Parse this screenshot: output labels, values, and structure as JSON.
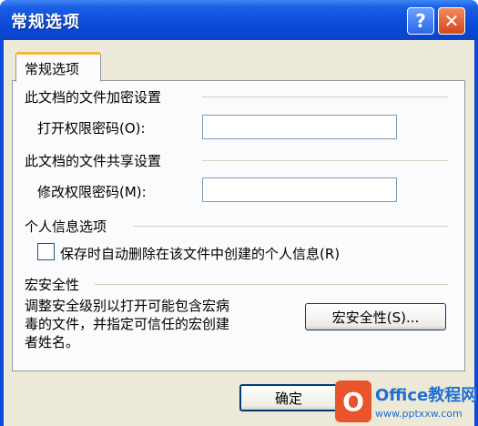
{
  "window": {
    "title": "常规选项",
    "help_label": "?",
    "close_label": "✕"
  },
  "tab": {
    "label": "常规选项"
  },
  "encryption": {
    "heading": "此文档的文件加密设置",
    "open_password_label": "打开权限密码(O):",
    "open_password_value": ""
  },
  "sharing": {
    "heading": "此文档的文件共享设置",
    "modify_password_label": "修改权限密码(M):",
    "modify_password_value": ""
  },
  "privacy": {
    "heading": "个人信息选项",
    "remove_info_label": "保存时自动删除在该文件中创建的个人信息(R)",
    "remove_info_checked": false
  },
  "macro": {
    "heading": "宏安全性",
    "description_line1": "调整安全级别以打开可能包含宏病",
    "description_line2": "毒的文件，并指定可信任的宏创建",
    "description_line3": "者姓名。",
    "button_label": "宏安全性(S)..."
  },
  "footer": {
    "ok_label": "确定"
  },
  "watermark": {
    "logo_letter": "O",
    "text": "Office教程网",
    "url": "www.pptxxw.com"
  },
  "colors": {
    "titlebar": "#0c4ad8",
    "client_bg": "#ece9d8",
    "tab_accent": "#f5b53a",
    "close_button": "#d6461c"
  }
}
